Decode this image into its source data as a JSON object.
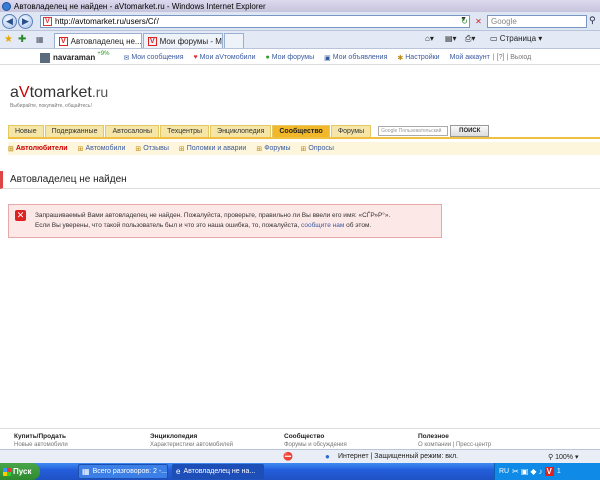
{
  "window": {
    "title": "Автовладелец не найден - aVtomarket.ru - Windows Internet Explorer"
  },
  "address_bar": {
    "url": "http://avtomarket.ru/users/Сѓ/",
    "search_placeholder": "Google"
  },
  "tabs": [
    {
      "label": "Автовладелец не..."
    },
    {
      "label": "Мои форумы - Мой..."
    }
  ],
  "toolbar": {
    "page_menu": "Страница"
  },
  "site_top": {
    "username": "navaraman",
    "rating": "+9%",
    "links": [
      {
        "label": "Мои сообщения",
        "icon": "envelope-icon"
      },
      {
        "label": "Мои аVтомобили",
        "icon": "heart-icon"
      },
      {
        "label": "Мои форумы",
        "icon": "forum-icon"
      },
      {
        "label": "Мои объявления",
        "icon": "ads-icon"
      },
      {
        "label": "Настройки",
        "icon": "settings-icon"
      },
      {
        "label": "Мой аккаунт",
        "icon": ""
      }
    ],
    "help": "[?]",
    "logout": "Выход"
  },
  "logo": {
    "a": "a",
    "v": "V",
    "rest": "tomarket",
    "ru": ".ru",
    "slogan": "Выбирайте, покупайте, общайтесь!"
  },
  "main_nav": {
    "items": [
      "Новые",
      "Подержанные",
      "Автосалоны",
      "Техцентры",
      "Энциклопедия",
      "Сообщество",
      "Форумы"
    ],
    "selected": "Сообщество",
    "search_placeholder": "Google  Пользовательский",
    "search_button": "ПОИСК"
  },
  "sub_nav": {
    "items": [
      "Автолюбители",
      "Автомобили",
      "Отзывы",
      "Поломки и аварии",
      "Форумы",
      "Опросы"
    ],
    "selected": "Автолюбители"
  },
  "page_title": "Автовладелец не найден",
  "error": {
    "line1": "Запрашиваемый Вами автовладелец не найден. Пожалуйста, проверьте, правильно ли Вы ввели его имя: «СЃР»Р°».",
    "line2_before": "Если Вы уверены, что такой пользователь был и что это наша ошибка, то, пожалуйста,",
    "line2_link": "сообщите нам",
    "line2_after": "об этом."
  },
  "footer": [
    {
      "heading": "Купить/Продать",
      "link": "Новые автомобили"
    },
    {
      "heading": "Энциклопедия",
      "link": "Характеристики автомобилей"
    },
    {
      "heading": "Сообщество",
      "link": "Форумы и обсуждения"
    },
    {
      "heading": "Полезное",
      "link": "О компании | Пресс-центр"
    }
  ],
  "status_bar": {
    "zone": "Интернет | Защищенный режим: вкл.",
    "zoom": "100%"
  },
  "taskbar": {
    "start": "Пуск",
    "buttons": [
      {
        "label": "Всего разговоров: 2 -..."
      },
      {
        "label": "Автовладелец не на..."
      }
    ],
    "lang": "RU",
    "clock": "1"
  }
}
